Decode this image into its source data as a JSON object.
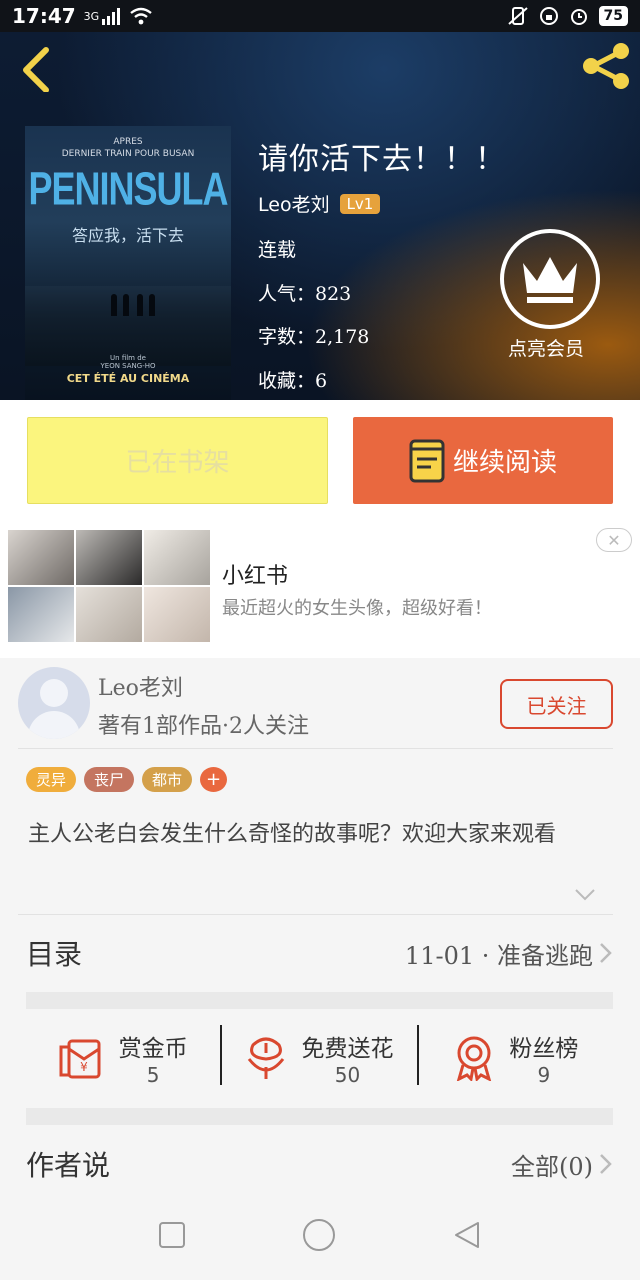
{
  "status_bar": {
    "time": "17:47",
    "network": "3G",
    "battery": "75"
  },
  "book": {
    "title": "请你活下去！！！",
    "author": "Leo老刘",
    "level": "Lv1",
    "status": "连载",
    "popularity": "人气：823",
    "word_count": "字数：2,178",
    "favorites": "收藏：6",
    "vip_label": "点亮会员"
  },
  "poster": {
    "top_text": "APRES\nDERNIER TRAIN POUR BUSAN",
    "title": "PENINSULA",
    "subtitle": "答应我，活下去",
    "credit": "Un film de\nYEON SANG-HO",
    "release": "CET ÉTÉ AU CINÉMA"
  },
  "actions": {
    "shelf_label": "已在书架",
    "read_label": "继续阅读"
  },
  "ad": {
    "title": "小红书",
    "description": "最近超火的女生头像，超级好看！",
    "close": "✕"
  },
  "author_card": {
    "name": "Leo老刘",
    "meta": "著有1部作品·2人关注",
    "follow_label": "已关注"
  },
  "tags": [
    {
      "label": "灵异",
      "color": "#f0ad3c"
    },
    {
      "label": "丧尸",
      "color": "#c47560"
    },
    {
      "label": "都市",
      "color": "#d4a04a"
    }
  ],
  "tag_add": "+",
  "description": "主人公老白会发生什么奇怪的故事呢？欢迎大家来观看",
  "catalog": {
    "label": "目录",
    "latest": "11-01 · 准备逃跑"
  },
  "stats": [
    {
      "label": "赏金币",
      "value": "5",
      "icon": "red-envelope-icon"
    },
    {
      "label": "免费送花",
      "value": "50",
      "icon": "flower-icon"
    },
    {
      "label": "粉丝榜",
      "value": "9",
      "icon": "medal-icon"
    }
  ],
  "author_says": {
    "label": "作者说",
    "right": "全部(0)"
  },
  "colors": {
    "accent": "#e9683f",
    "follow": "#d9482f",
    "shelf_bg": "#fbf57e"
  }
}
